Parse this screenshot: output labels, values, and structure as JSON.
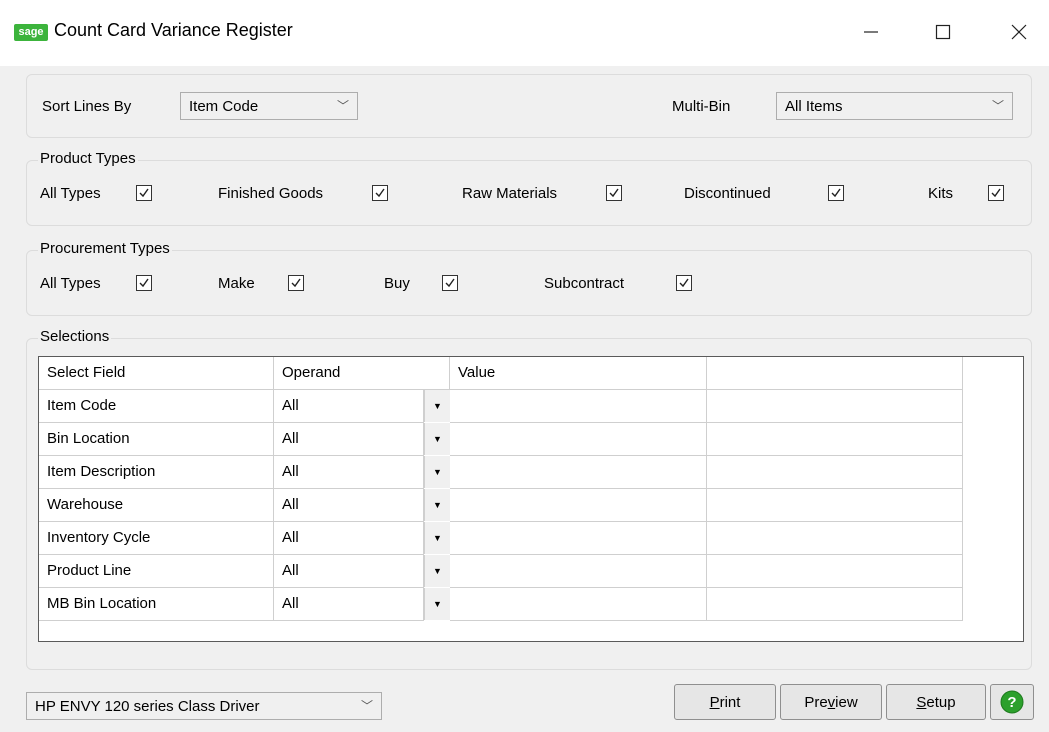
{
  "window": {
    "title": "Count Card Variance Register",
    "logo": "sage"
  },
  "sort": {
    "label": "Sort Lines By",
    "value": "Item Code"
  },
  "multibin": {
    "label": "Multi-Bin",
    "value": "All Items"
  },
  "product_types": {
    "legend": "Product Types",
    "items": [
      {
        "label": "All Types",
        "checked": true
      },
      {
        "label": "Finished Goods",
        "checked": true
      },
      {
        "label": "Raw Materials",
        "checked": true
      },
      {
        "label": "Discontinued",
        "checked": true
      },
      {
        "label": "Kits",
        "checked": true
      }
    ]
  },
  "procurement_types": {
    "legend": "Procurement Types",
    "items": [
      {
        "label": "All Types",
        "checked": true
      },
      {
        "label": "Make",
        "checked": true
      },
      {
        "label": "Buy",
        "checked": true
      },
      {
        "label": "Subcontract",
        "checked": true
      }
    ]
  },
  "selections": {
    "legend": "Selections",
    "columns": [
      "Select Field",
      "Operand",
      "Value",
      ""
    ],
    "rows": [
      {
        "field": "Item Code",
        "operand": "All",
        "value": ""
      },
      {
        "field": "Bin Location",
        "operand": "All",
        "value": ""
      },
      {
        "field": "Item Description",
        "operand": "All",
        "value": ""
      },
      {
        "field": "Warehouse",
        "operand": "All",
        "value": ""
      },
      {
        "field": "Inventory Cycle",
        "operand": "All",
        "value": ""
      },
      {
        "field": "Product Line",
        "operand": "All",
        "value": ""
      },
      {
        "field": "MB Bin Location",
        "operand": "All",
        "value": ""
      }
    ]
  },
  "printer": {
    "value": "HP ENVY 120 series Class Driver"
  },
  "buttons": {
    "print": {
      "pre": "",
      "u": "P",
      "post": "rint"
    },
    "preview": {
      "pre": "Pre",
      "u": "v",
      "post": "iew"
    },
    "setup": {
      "pre": "",
      "u": "S",
      "post": "etup"
    }
  },
  "colors": {
    "help": "#2ca02c",
    "logo": "#3cb43c"
  }
}
